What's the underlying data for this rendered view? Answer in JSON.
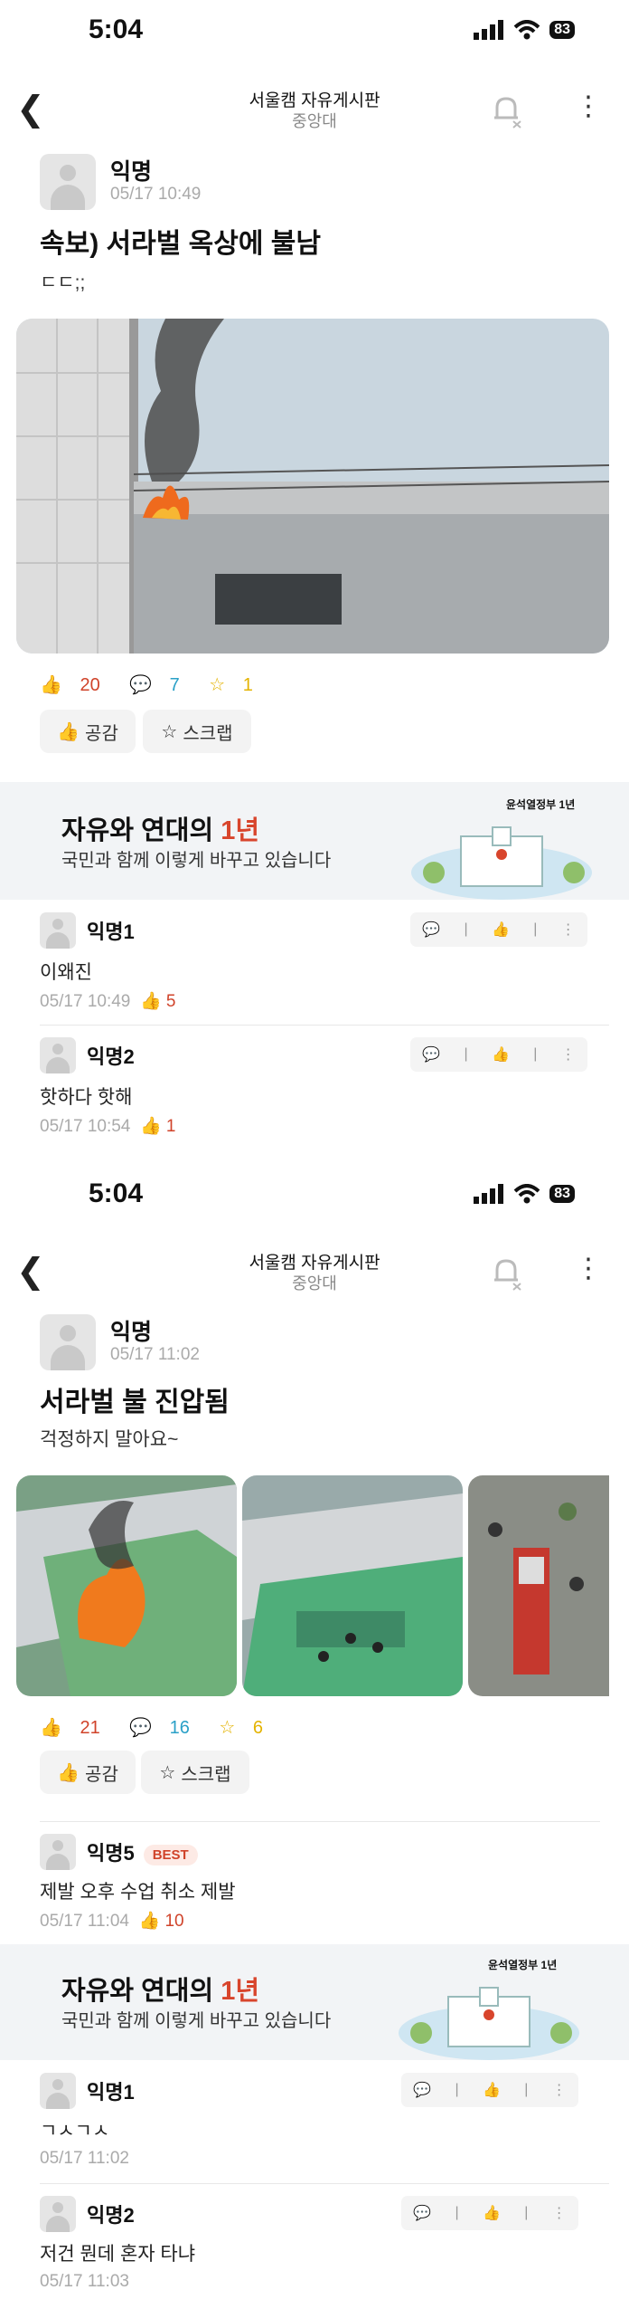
{
  "screens": [
    {
      "status": {
        "time": "5:04",
        "battery": "83"
      },
      "nav": {
        "title": "서울캠 자유게시판",
        "subtitle": "중앙대"
      },
      "post": {
        "author": "익명",
        "date": "05/17 10:49",
        "title": "속보) 서라벌 옥상에 불남",
        "body": "ㄷㄷ;;",
        "stats": {
          "likes": "20",
          "comments": "7",
          "scraps": "1"
        },
        "buttons": {
          "like": "공감",
          "scrap": "스크랩"
        }
      },
      "ad": {
        "headline_a": "자유와 연대의 ",
        "headline_b": "1년",
        "subline": "국민과 함께 이렇게 바꾸고 있습니다",
        "badge": "윤석열정부 1년"
      },
      "comments": [
        {
          "author": "익명1",
          "text": "이왜진",
          "date": "05/17 10:49",
          "likes": "5"
        },
        {
          "author": "익명2",
          "text": "핫하다 핫해",
          "date": "05/17 10:54",
          "likes": "1"
        }
      ]
    },
    {
      "status": {
        "time": "5:04",
        "battery": "83"
      },
      "nav": {
        "title": "서울캠 자유게시판",
        "subtitle": "중앙대"
      },
      "post": {
        "author": "익명",
        "date": "05/17 11:02",
        "title": "서라벌 불 진압됨",
        "body": "걱정하지 말아요~",
        "stats": {
          "likes": "21",
          "comments": "16",
          "scraps": "6"
        },
        "buttons": {
          "like": "공감",
          "scrap": "스크랩"
        }
      },
      "best_comment": {
        "author": "익명5",
        "badge": "BEST",
        "text": "제발 오후 수업 취소 제발",
        "date": "05/17 11:04",
        "likes": "10"
      },
      "ad": {
        "headline_a": "자유와 연대의 ",
        "headline_b": "1년",
        "subline": "국민과 함께 이렇게 바꾸고 있습니다",
        "badge": "윤석열정부 1년"
      },
      "comments": [
        {
          "author": "익명1",
          "text": "ㄱㅅㄱㅅ",
          "date": "05/17 11:02"
        },
        {
          "author": "익명2",
          "text": "저건 뭔데 혼자 타냐",
          "date": "05/17 11:03"
        }
      ]
    }
  ]
}
